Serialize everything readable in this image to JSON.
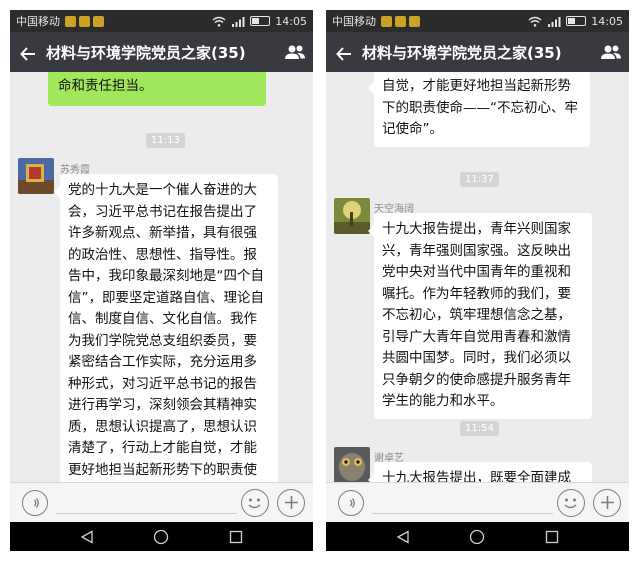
{
  "status_bar": {
    "carrier": "中国移动",
    "time": "14:05"
  },
  "header": {
    "title": "材料与环境学院党员之家(35)"
  },
  "left": {
    "top_bubble": "命和责任担当。",
    "timestamp": "11:13",
    "message": {
      "sender": "苏秀霞",
      "text": "党的十九大是一个催人奋进的大会，习近平总书记在报告提出了许多新观点、新举措，具有很强的政治性、思想性、指导性。报告中，我印象最深刻地是“四个自信”，即要坚定道路自信、理论自信、制度自信、文化自信。我作为我们学院党总支组织委员，要紧密结合工作实际，充分运用多种形式，对习近平总书记的报告进行再学习，深刻领会其精神实质，思想认识提高了，思想认识清楚了，行动上才能自觉，才能更好地担当起新形势下的职责使命——“不忘初心、牢记使命”。"
    }
  },
  "right": {
    "top_bubble": "自觉，才能更好地担当起新形势下的职责使命——“不忘初心、牢记使命”。",
    "timestamp1": "11:37",
    "message1": {
      "sender": "天空海阔",
      "text": "十九大报告提出，青年兴则国家兴，青年强则国家强。这反映出党中央对当代中国青年的重视和嘱托。作为年轻教师的我们，要不忘初心，筑牢理想信念之基，引导广大青年自觉用青春和激情共圆中国梦。同时，我们必须以只争朝夕的使命感提升服务青年学生的能力和水平。"
    },
    "timestamp2": "11:54",
    "message2": {
      "sender": "谢卓艺",
      "text": "十九大报告提出，既要全面建成小"
    }
  },
  "colors": {
    "title_bar": "#393a3f",
    "status_bar": "#2c2c2c",
    "chat_bg": "#ececec",
    "self_bubble": "#a0e75a",
    "other_bubble": "#ffffff",
    "nav_bar": "#000000"
  },
  "icons": [
    "back-arrow-icon",
    "group-members-icon",
    "voice-icon",
    "emoji-icon",
    "plus-icon",
    "nav-back-icon",
    "nav-home-icon",
    "nav-recent-icon",
    "wifi-icon",
    "signal-icon",
    "battery-icon"
  ]
}
